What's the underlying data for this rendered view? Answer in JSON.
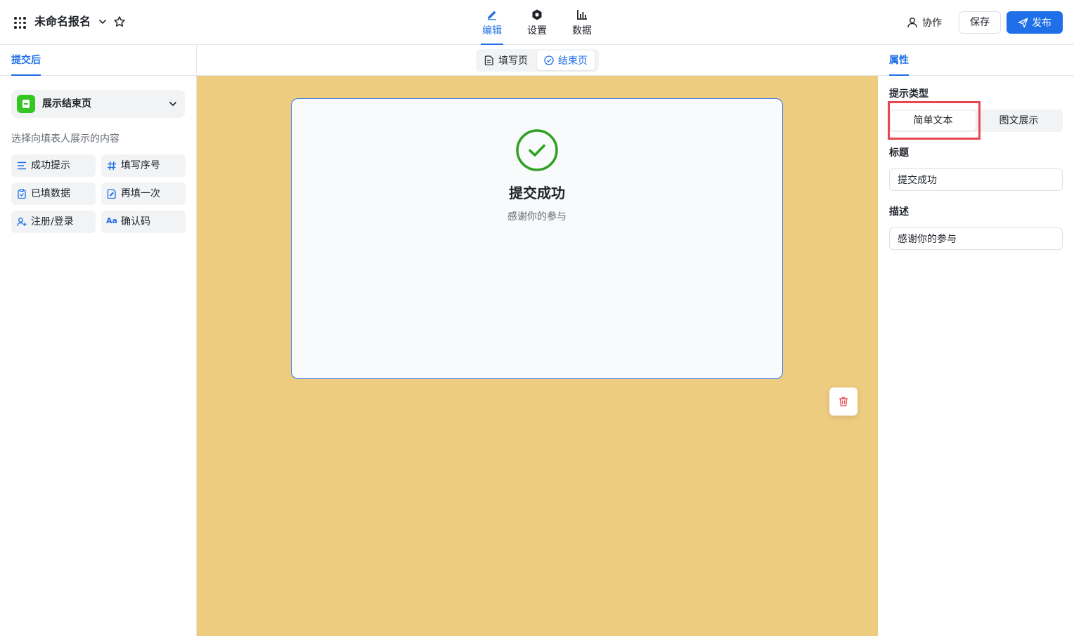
{
  "app": {
    "form_title": "未命名报名"
  },
  "nav": {
    "tabs": [
      {
        "label": "编辑",
        "active": true
      },
      {
        "label": "设置",
        "active": false
      },
      {
        "label": "数据",
        "active": false
      }
    ]
  },
  "actions": {
    "collab_label": "协作",
    "save_label": "保存",
    "publish_label": "发布"
  },
  "left_panel": {
    "tab_label": "提交后",
    "end_page_select": "展示结束页",
    "section_hint": "选择向填表人展示的内容",
    "components": [
      {
        "label": "成功提示",
        "icon": "lines-icon"
      },
      {
        "label": "填写序号",
        "icon": "hash-icon"
      },
      {
        "label": "已填数据",
        "icon": "clipboard-icon"
      },
      {
        "label": "再填一次",
        "icon": "edit-doc-icon"
      },
      {
        "label": "注册/登录",
        "icon": "user-add-icon"
      },
      {
        "label": "确认码",
        "icon_text": "Aa"
      }
    ]
  },
  "canvas": {
    "page_tabs": [
      {
        "label": "填写页",
        "active": false
      },
      {
        "label": "结束页",
        "active": true
      }
    ],
    "success_title": "提交成功",
    "success_desc": "感谢你的参与",
    "background_color": "#edcc80"
  },
  "right_panel": {
    "tab_label": "属性",
    "hint_type_label": "提示类型",
    "hint_types": [
      {
        "label": "简单文本",
        "active": true
      },
      {
        "label": "图文展示",
        "active": false
      }
    ],
    "title_label": "标题",
    "title_value": "提交成功",
    "desc_label": "描述",
    "desc_value": "感谢你的参与"
  },
  "colors": {
    "accent": "#1e6fe8",
    "success": "#2ea121",
    "danger": "#e8474f"
  }
}
